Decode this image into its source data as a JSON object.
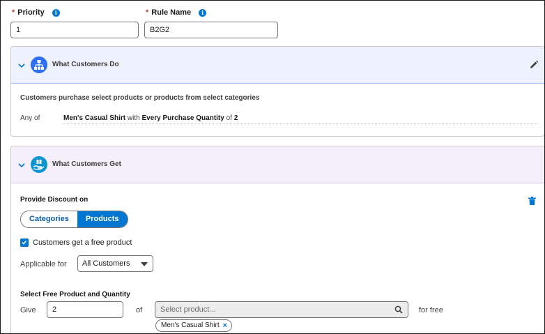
{
  "priority": {
    "required_mark": "*",
    "label": "Priority",
    "value": "1"
  },
  "rule_name": {
    "required_mark": "*",
    "label": "Rule Name",
    "value": "B2G2"
  },
  "customers_do": {
    "title": "What Customers Do",
    "description": "Customers purchase select products or products from select categories",
    "condition": {
      "prefix": "Any of",
      "product": "Men's Casual Shirt",
      "with": "with",
      "quantity_label": "Every Purchase Quantity",
      "of": "of",
      "quantity": "2"
    }
  },
  "customers_get": {
    "title": "What Customers Get",
    "discount_label": "Provide Discount on",
    "segments": [
      "Categories",
      "Products"
    ],
    "active_segment": "Products",
    "free_product_checkbox": {
      "label": "Customers get a free product",
      "checked": true
    },
    "applicable_label": "Applicable for",
    "applicable_value": "All Customers",
    "select_section_label": "Select Free Product and Quantity",
    "give_label": "Give",
    "give_value": "2",
    "of_label": "of",
    "product_placeholder": "Select product...",
    "for_free_label": "for free",
    "selected_pill": "Men's Casual Shirt"
  },
  "colors": {
    "accent": "#0176d3",
    "header_blue": "#eef1fe",
    "header_purple": "#f5eefb",
    "required": "#c23934"
  },
  "icons": {
    "info": "info-icon",
    "chevron": "chevron-down-icon",
    "customers_do": "hierarchy-icon",
    "customers_get": "gift-hand-icon",
    "edit": "pencil-icon",
    "delete": "trash-icon",
    "search": "search-icon",
    "remove": "close-icon"
  }
}
